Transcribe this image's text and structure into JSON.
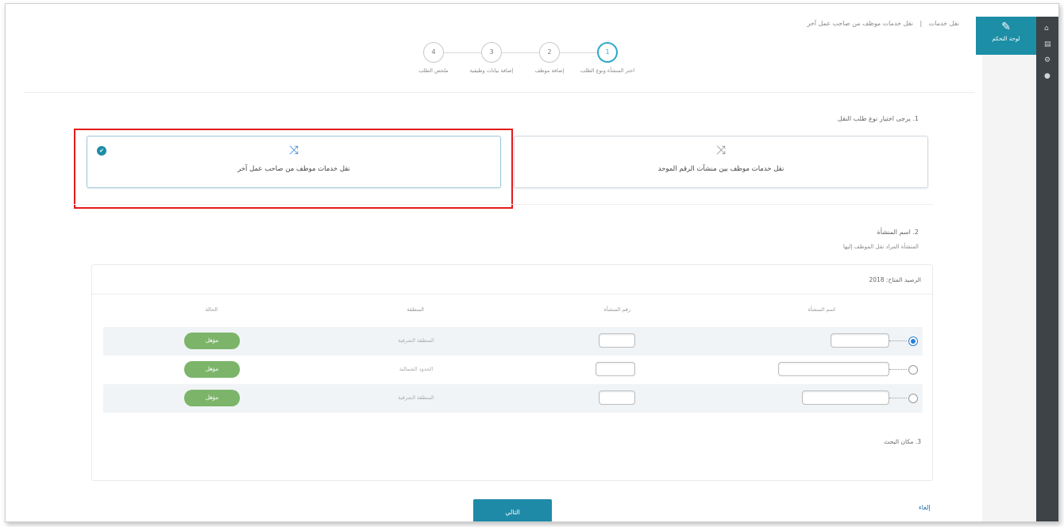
{
  "breadcrumb": [
    "نقل خدمات",
    "نقل خدمات موظف من صاحب عمل آخر"
  ],
  "stepper": {
    "steps": [
      {
        "num": "4",
        "label": "ملخص الطلب"
      },
      {
        "num": "3",
        "label": "إضافة بيانات وظيفية"
      },
      {
        "num": "2",
        "label": "إضافة موظف"
      },
      {
        "num": "1",
        "label": "اختر المنشأة ونوع الطلب"
      }
    ]
  },
  "sidebar": {
    "active_label": "لوحة التحكم"
  },
  "question1": "1. يرجى اختيار نوع طلب النقل",
  "options": [
    {
      "label": "نقل خدمات موظف من صاحب عمل آخر",
      "selected": true
    },
    {
      "label": "نقل خدمات موظف بين منشآت الرقم الموحد",
      "selected": false
    }
  ],
  "question2": {
    "title": "2. اسم المنشأة",
    "subtitle": "المنشأة المراد نقل الموظف إليها"
  },
  "table": {
    "year_label": "الرصيد المتاح: 2018",
    "headers": {
      "name": "اسم المنشأة",
      "number": "رقم المنشأة",
      "region": "المنطقة",
      "status": "الحالة"
    },
    "rows": [
      {
        "region": "المنطقة الشرقية",
        "status": "مؤهل",
        "selected": true
      },
      {
        "region": "الحدود الشمالية",
        "status": "مؤهل",
        "selected": false
      },
      {
        "region": "المنطقة الشرقية",
        "status": "مؤهل",
        "selected": false
      }
    ],
    "more_label": "3. مكان البحث"
  },
  "buttons": {
    "next": "التالي",
    "cancel": "إلغاء"
  },
  "colors": {
    "accent": "#1f8aa8",
    "eligible": "#7cb56a",
    "highlight": "#e31b1b"
  }
}
